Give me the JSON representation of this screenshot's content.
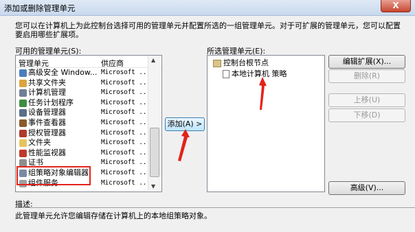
{
  "window": {
    "title": "添加或删除管理单元",
    "close_label": "X"
  },
  "intro_text": "您可以在计算机上为此控制台选择可用的管理单元并配置所选的一组管理单元。对于可扩展的管理单元，您可以配置要启用哪些扩展项。",
  "available": {
    "label": "可用的管理单元(S):",
    "col_name": "管理单元",
    "col_vendor": "供应商",
    "rows": [
      {
        "name": "高级安全 Window...",
        "vendor": "Microsoft ...",
        "color": "#4a7ebb"
      },
      {
        "name": "共享文件夹",
        "vendor": "Microsoft ...",
        "color": "#d9a441"
      },
      {
        "name": "计算机管理",
        "vendor": "Microsoft ...",
        "color": "#6f7f96"
      },
      {
        "name": "任务计划程序",
        "vendor": "Microsoft ...",
        "color": "#3e8e3e"
      },
      {
        "name": "设备管理器",
        "vendor": "Microsoft ...",
        "color": "#5a6e88"
      },
      {
        "name": "事件查看器",
        "vendor": "Microsoft ...",
        "color": "#8b5a2b"
      },
      {
        "name": "授权管理器",
        "vendor": "Microsoft ...",
        "color": "#b03a2e"
      },
      {
        "name": "文件夹",
        "vendor": "Microsoft ...",
        "color": "#e6c45c"
      },
      {
        "name": "性能监视器",
        "vendor": "Microsoft ...",
        "color": "#c0392b"
      },
      {
        "name": "证书",
        "vendor": "Microsoft ...",
        "color": "#8e8e8e"
      },
      {
        "name": "组策略对象编辑器",
        "vendor": "Microsoft ...",
        "color": "#7a8aa6"
      },
      {
        "name": "组件服务",
        "vendor": "Microsoft ...",
        "color": "#a0a0a0"
      }
    ]
  },
  "add_button": "添加(A) >",
  "selected": {
    "label": "所选管理单元(E):",
    "root": "控制台根节点",
    "child": "本地计算机 策略"
  },
  "buttons": {
    "edit_ext": "编辑扩展(X)...",
    "remove": "删除(R)",
    "move_up": "上移(U)",
    "move_down": "下移(D)",
    "advanced": "高级(V)..."
  },
  "description": {
    "label": "描述:",
    "text": "此管理单元允许您编辑存储在计算机上的本地组策略对象。"
  },
  "colors": {
    "annotation_red": "#e2231a",
    "title_bar": "#c9d9ee"
  }
}
